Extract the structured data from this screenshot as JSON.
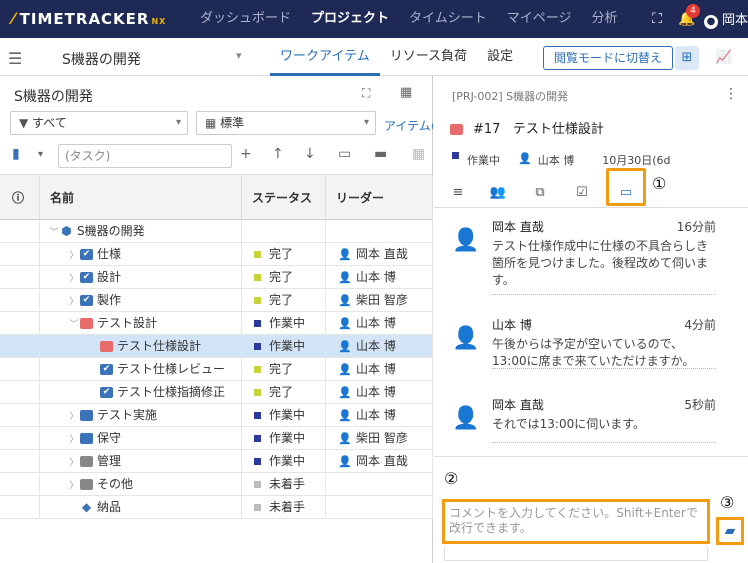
{
  "app": {
    "logo": "TIMETRACKER",
    "logo_suffix": "NX",
    "nav": [
      "ダッシュボード",
      "プロジェクト",
      "タイムシート",
      "マイページ",
      "分析"
    ],
    "nav_active": 1,
    "notification_count": "4",
    "user_name": "岡本"
  },
  "subbar": {
    "project_name": "S機器の開発",
    "tabs": [
      "ワークアイテム",
      "リソース負荷",
      "設定"
    ],
    "active_tab": 0,
    "viewmode_button": "閲覧モードに切替え"
  },
  "left": {
    "title": "S機器の開発",
    "filter_all": "すべて",
    "filter_standard": "標準",
    "item_link": "アイテムの",
    "task_placeholder": "(タスク)",
    "columns": [
      "名前",
      "ステータス",
      "リーダー"
    ]
  },
  "rows": [
    {
      "name": "S機器の開発",
      "indent": 0,
      "exp": "v",
      "icon": "cube-icon",
      "iconColor": "#3a73b8",
      "status": "",
      "statusColor": "",
      "leader": ""
    },
    {
      "name": "仕様",
      "indent": 1,
      "exp": ">",
      "icon": "check-icon",
      "iconColor": "#3a73b8",
      "status": "完了",
      "statusColor": "#c6d33a",
      "leader": "岡本 直哉"
    },
    {
      "name": "設計",
      "indent": 1,
      "exp": ">",
      "icon": "check-icon",
      "iconColor": "#3a73b8",
      "status": "完了",
      "statusColor": "#c6d33a",
      "leader": "山本 博"
    },
    {
      "name": "製作",
      "indent": 1,
      "exp": ">",
      "icon": "check-icon",
      "iconColor": "#3a73b8",
      "status": "完了",
      "statusColor": "#c6d33a",
      "leader": "柴田 智彦"
    },
    {
      "name": "テスト設計",
      "indent": 1,
      "exp": "v",
      "icon": "folder-icon",
      "iconColor": "#e86a6a",
      "status": "作業中",
      "statusColor": "#2b3a9b",
      "leader": "山本 博"
    },
    {
      "name": "テスト仕様設計",
      "indent": 2,
      "exp": "",
      "icon": "task-icon",
      "iconColor": "#e86a6a",
      "status": "作業中",
      "statusColor": "#2b3a9b",
      "leader": "山本 博",
      "selected": true
    },
    {
      "name": "テスト仕様レビュー",
      "indent": 2,
      "exp": "",
      "icon": "task-check-icon",
      "iconColor": "#3a73b8",
      "status": "完了",
      "statusColor": "#c6d33a",
      "leader": "山本 博"
    },
    {
      "name": "テスト仕様指摘修正",
      "indent": 2,
      "exp": "",
      "icon": "task-check-icon",
      "iconColor": "#3a73b8",
      "status": "完了",
      "statusColor": "#c6d33a",
      "leader": "山本 博"
    },
    {
      "name": "テスト実施",
      "indent": 1,
      "exp": ">",
      "icon": "folder-icon",
      "iconColor": "#3a73b8",
      "status": "作業中",
      "statusColor": "#2b3a9b",
      "leader": "山本 博"
    },
    {
      "name": "保守",
      "indent": 1,
      "exp": ">",
      "icon": "folder-icon",
      "iconColor": "#3a73b8",
      "status": "作業中",
      "statusColor": "#2b3a9b",
      "leader": "柴田 智彦"
    },
    {
      "name": "管理",
      "indent": 1,
      "exp": ">",
      "icon": "folder-icon",
      "iconColor": "#888888",
      "status": "作業中",
      "statusColor": "#2b3a9b",
      "leader": "岡本 直哉"
    },
    {
      "name": "その他",
      "indent": 1,
      "exp": ">",
      "icon": "folder-icon",
      "iconColor": "#888888",
      "status": "未着手",
      "statusColor": "#bbbbbb",
      "leader": ""
    },
    {
      "name": "納品",
      "indent": 1,
      "exp": "",
      "icon": "diamond-icon",
      "iconColor": "#3a73b8",
      "status": "未着手",
      "statusColor": "#bbbbbb",
      "leader": ""
    }
  ],
  "detail": {
    "breadcrumb": "[PRJ-002] S機器の開発",
    "item_no": "#17",
    "item_title": "テスト仕様設計",
    "status": "作業中",
    "leader": "山本 博",
    "date": "10月30日(6d"
  },
  "comments": [
    {
      "author": "岡本 直哉",
      "time": "16分前",
      "text": "テスト仕様作成中に仕様の不具合らしき箇所を見つけました。後程改めて伺います。"
    },
    {
      "author": "山本 博",
      "time": "4分前",
      "text": "午後からは予定が空いているので、13:00に席まで来ていただけますか。"
    },
    {
      "author": "岡本 直哉",
      "time": "5秒前",
      "text": "それでは13:00に伺います。"
    }
  ],
  "comment_placeholder": "コメントを入力してください。Shift+Enterで改行できます。",
  "markers": [
    "①",
    "②",
    "③"
  ]
}
